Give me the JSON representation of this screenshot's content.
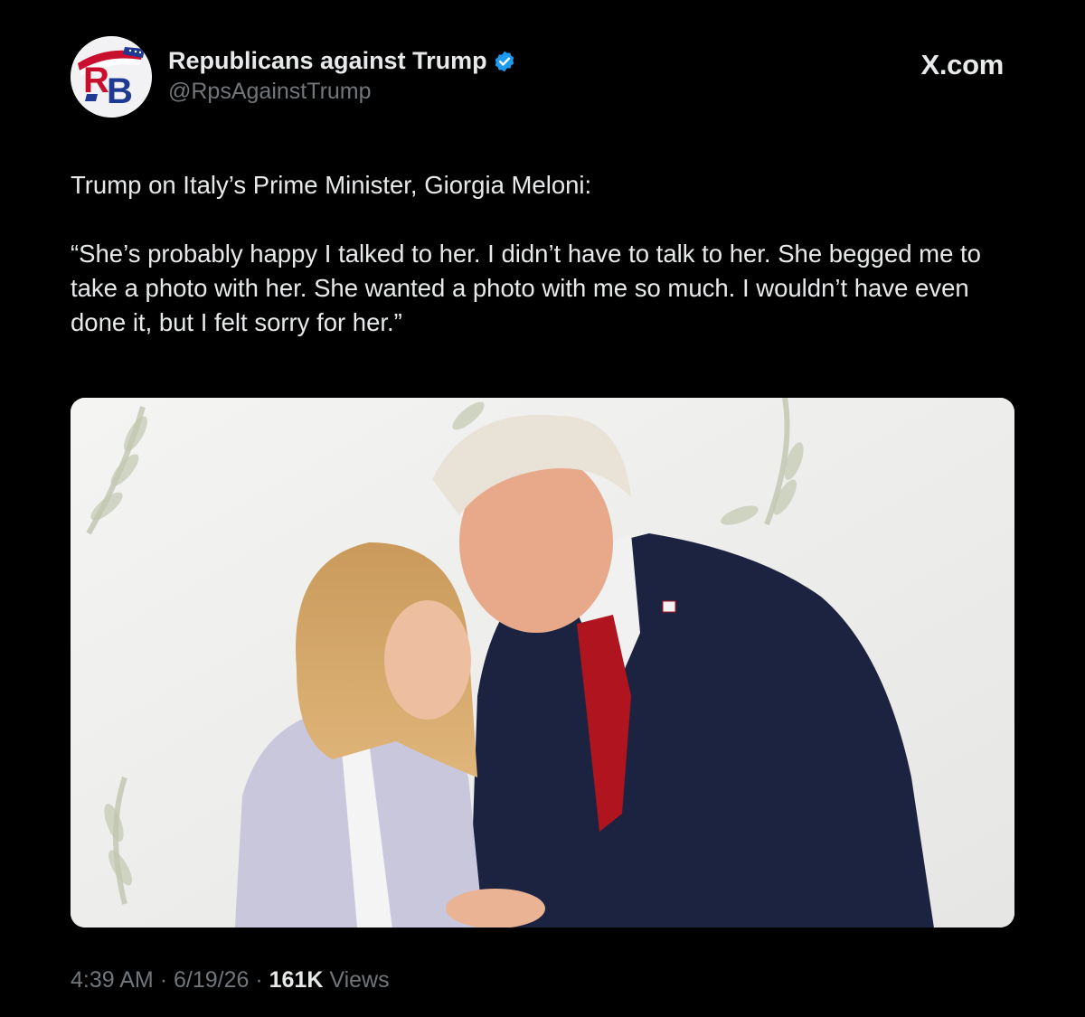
{
  "header": {
    "display_name": "Republicans against Trump",
    "handle": "@RpsAgainstTrump",
    "brand": "X.com",
    "avatar_letters": "RB",
    "avatar_icon": "rb-logo-icon",
    "verified_icon": "verified-badge-icon"
  },
  "tweet": {
    "line1": "Trump on Italy’s Prime Minister, Giorgia Meloni:",
    "quote": "“She’s probably happy I talked to her. I didn’t have to talk to her. She begged me to take a photo with her. She wanted a photo with me so much. I wouldn’t have even done it, but I felt sorry for her.”"
  },
  "media": {
    "kind": "photo",
    "description_icon": "photo-handshake-image"
  },
  "meta": {
    "time": "4:39 AM",
    "separator": "·",
    "date": "6/19/26",
    "views_count": "161K",
    "views_label": "Views"
  },
  "colors": {
    "background": "#000000",
    "text_primary": "#e7e9ea",
    "text_secondary": "#71767b",
    "verified_blue": "#1d9bf0",
    "avatar_red": "#c8102e",
    "avatar_blue": "#1f3a93"
  }
}
